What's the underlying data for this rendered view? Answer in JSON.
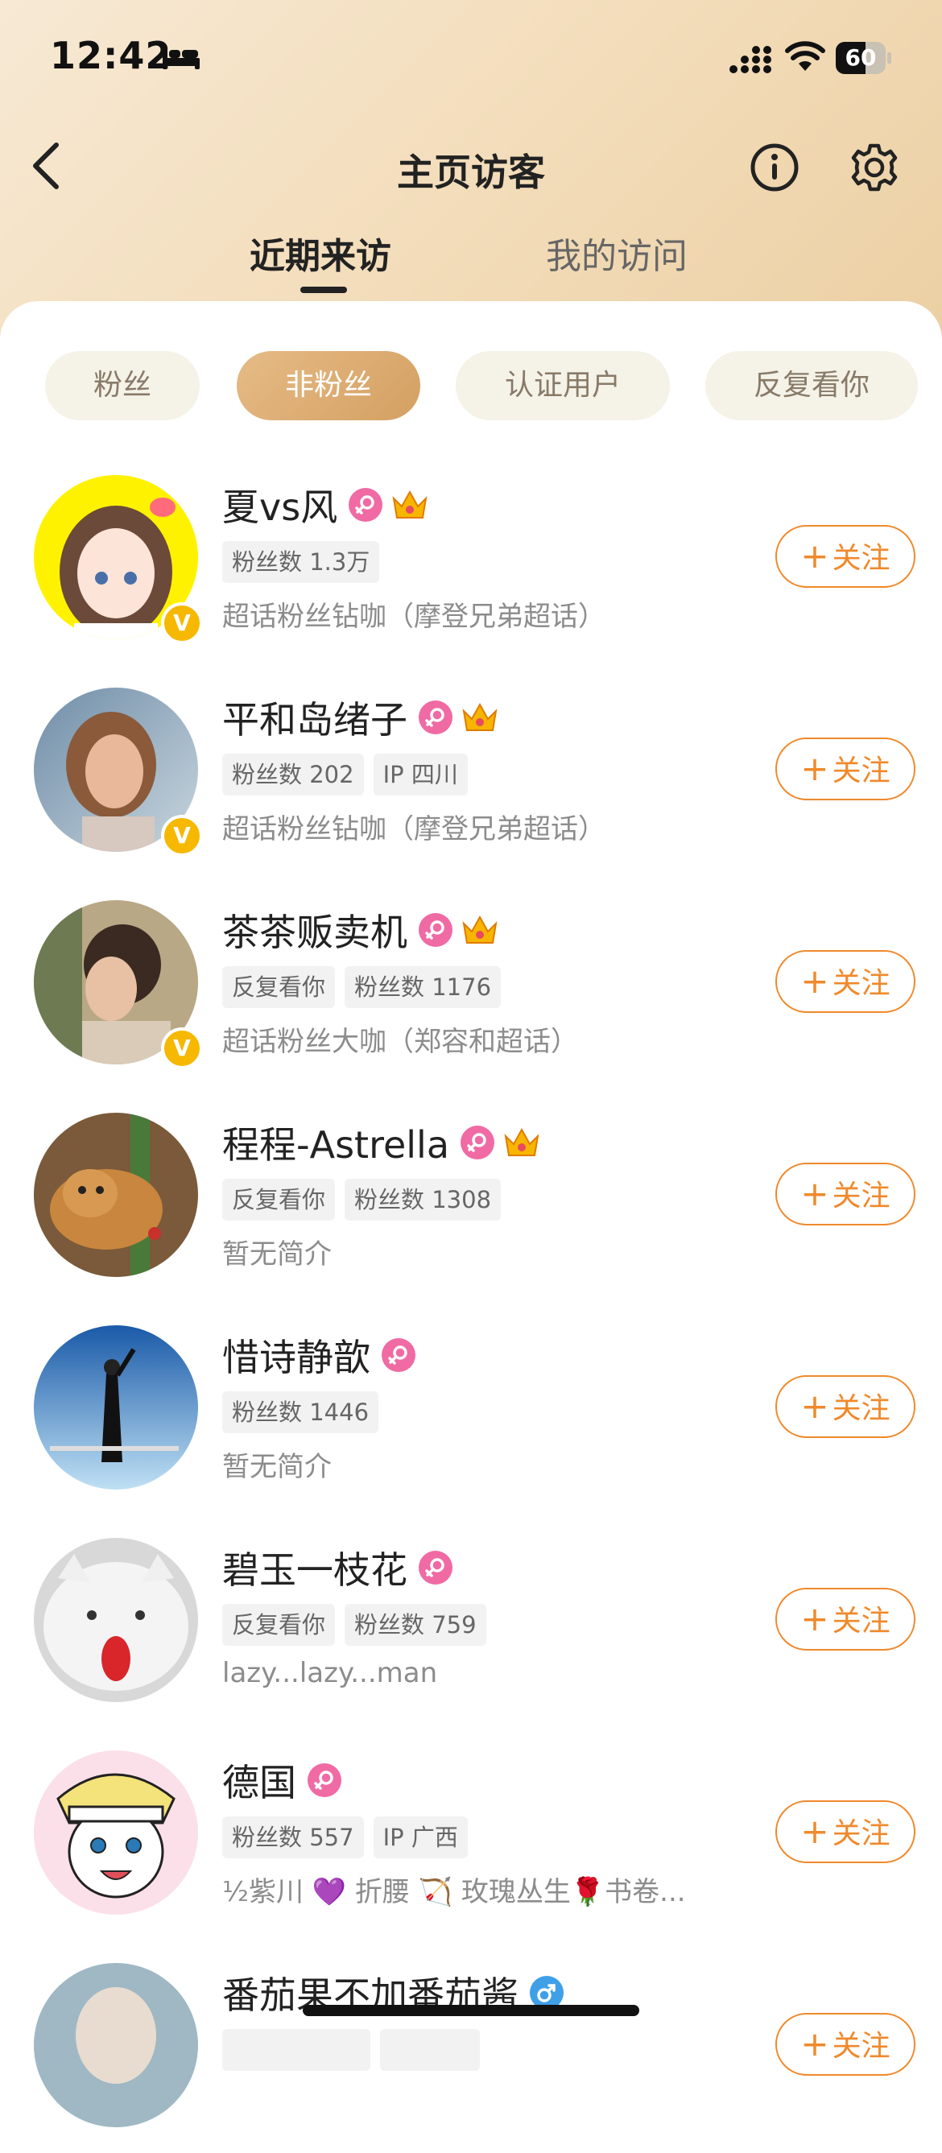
{
  "status_bar": {
    "time": "12:42",
    "battery": "60",
    "battery_level": 0.6
  },
  "header": {
    "title": "主页访客"
  },
  "tabs": [
    {
      "label": "近期来访"
    },
    {
      "label": "我的访问"
    }
  ],
  "filters": [
    {
      "label": "粉丝"
    },
    {
      "label": "非粉丝"
    },
    {
      "label": "认证用户"
    },
    {
      "label": "反复看你"
    }
  ],
  "active_filter": "非粉丝",
  "follow_label": "关注",
  "users": [
    {
      "name": "夏vs风",
      "tags": [
        "粉丝数 1.3万"
      ],
      "bio": "超话粉丝钻咖（摩登兄弟超话）"
    },
    {
      "name": "平和岛绪子",
      "tags": [
        "粉丝数 202",
        "IP 四川"
      ],
      "bio": "超话粉丝钻咖（摩登兄弟超话）"
    },
    {
      "name": "茶茶贩卖机",
      "tags": [
        "反复看你",
        "粉丝数 1176"
      ],
      "bio": "超话粉丝大咖（郑容和超话）"
    },
    {
      "name": "程程-Astrella",
      "tags": [
        "反复看你",
        "粉丝数 1308"
      ],
      "bio": "暂无简介"
    },
    {
      "name": "惜诗静歆",
      "tags": [
        "粉丝数 1446"
      ],
      "bio": "暂无简介"
    },
    {
      "name": "碧玉一枝花",
      "tags": [
        "反复看你",
        "粉丝数 759"
      ],
      "bio": "lazy...lazy...man"
    },
    {
      "name": "德国",
      "tags": [
        "粉丝数 557",
        "IP 广西"
      ],
      "bio": "½紫川 💜 折腰 🏹 玫瑰丛生🌹书卷..."
    },
    {
      "name": "番茄果不加番茄酱",
      "tags": [],
      "bio": ""
    }
  ],
  "colors": {
    "accent": "#f0892b",
    "female": "#f06aa4",
    "male": "#3fa0e8",
    "verified": "#f6b800"
  }
}
